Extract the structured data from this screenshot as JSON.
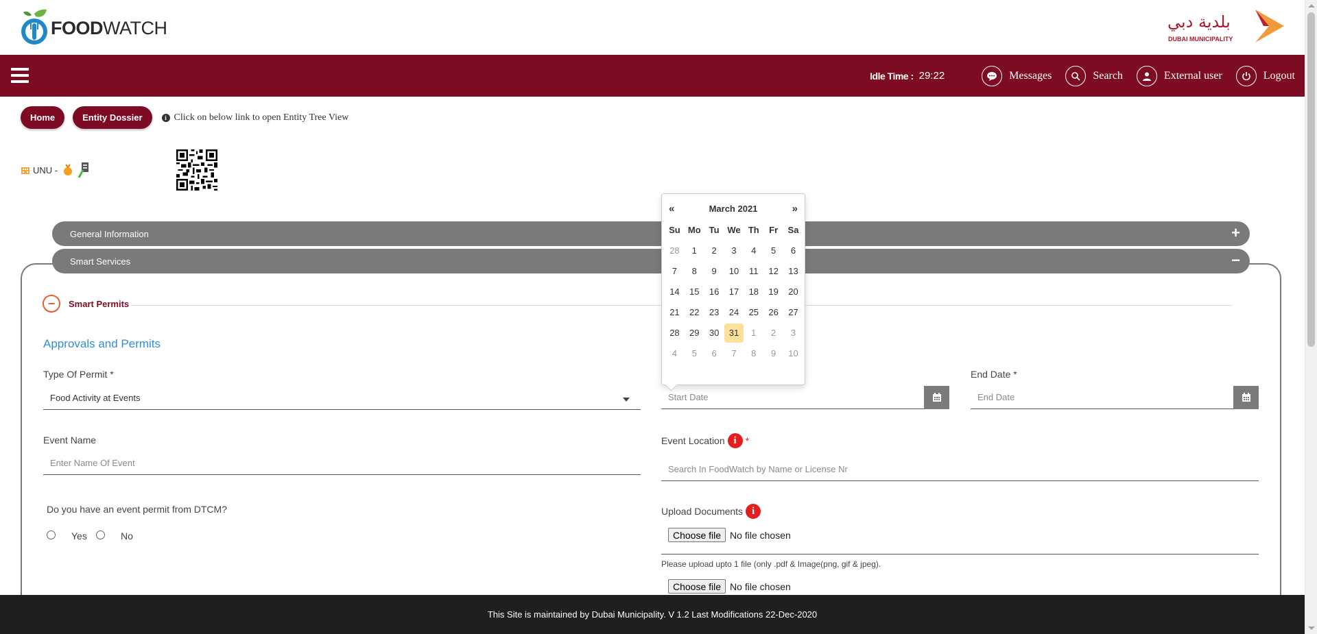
{
  "brand": {
    "logo_bold": "FOOD",
    "logo_light": "WATCH",
    "municipality_arabic": "بلدية دبي",
    "municipality_latin": "DUBAI MUNICIPALITY"
  },
  "navbar": {
    "idle_label": "Idle Time :",
    "idle_value": "29:22",
    "items": [
      {
        "label": "Messages",
        "icon": "chat-icon"
      },
      {
        "label": "Search",
        "icon": "search-icon"
      },
      {
        "label": "External user",
        "icon": "user-icon"
      },
      {
        "label": "Logout",
        "icon": "power-icon"
      }
    ]
  },
  "breadcrumb": {
    "home": "Home",
    "dossier": "Entity Dossier",
    "note": "Click on below link to open Entity Tree View"
  },
  "entity": {
    "label": "UNU -"
  },
  "accordion": {
    "general": "General Information",
    "smart": "Smart Services",
    "general_sign": "+",
    "smart_sign": "−"
  },
  "smart_permits": {
    "title": "Smart Permits",
    "section_title": "Approvals and Permits"
  },
  "form": {
    "type_label": "Type Of Permit *",
    "type_value": "Food Activity at Events",
    "start_placeholder": "Start Date",
    "end_label": "End Date *",
    "end_placeholder": "End Date",
    "event_name_label": "Event Name",
    "event_name_placeholder": "Enter Name Of Event",
    "location_label": "Event Location",
    "location_placeholder": "Search In FoodWatch by Name or License Nr",
    "dtcm_question": "Do you have an event permit from DTCM?",
    "yes": "Yes",
    "no": "No",
    "upload_label": "Upload Documents",
    "choose_file": "Choose file",
    "no_file": "No file chosen",
    "upload_hint": "Please upload upto 1 file (only .pdf & Image(png, gif & jpeg).",
    "required_mark": "*",
    "info_glyph": "i"
  },
  "datepicker": {
    "prev": "«",
    "next": "»",
    "month": "March 2021",
    "dow": [
      "Su",
      "Mo",
      "Tu",
      "We",
      "Th",
      "Fr",
      "Sa"
    ],
    "weeks": [
      [
        {
          "d": "28",
          "o": true
        },
        {
          "d": "1"
        },
        {
          "d": "2"
        },
        {
          "d": "3"
        },
        {
          "d": "4"
        },
        {
          "d": "5"
        },
        {
          "d": "6"
        }
      ],
      [
        {
          "d": "7"
        },
        {
          "d": "8"
        },
        {
          "d": "9"
        },
        {
          "d": "10"
        },
        {
          "d": "11"
        },
        {
          "d": "12"
        },
        {
          "d": "13"
        }
      ],
      [
        {
          "d": "14"
        },
        {
          "d": "15"
        },
        {
          "d": "16"
        },
        {
          "d": "17"
        },
        {
          "d": "18"
        },
        {
          "d": "19"
        },
        {
          "d": "20"
        }
      ],
      [
        {
          "d": "21"
        },
        {
          "d": "22"
        },
        {
          "d": "23"
        },
        {
          "d": "24"
        },
        {
          "d": "25"
        },
        {
          "d": "26"
        },
        {
          "d": "27"
        }
      ],
      [
        {
          "d": "28"
        },
        {
          "d": "29"
        },
        {
          "d": "30"
        },
        {
          "d": "31",
          "t": true
        },
        {
          "d": "1",
          "o": true
        },
        {
          "d": "2",
          "o": true
        },
        {
          "d": "3",
          "o": true
        }
      ],
      [
        {
          "d": "4",
          "o": true
        },
        {
          "d": "5",
          "o": true
        },
        {
          "d": "6",
          "o": true
        },
        {
          "d": "7",
          "o": true
        },
        {
          "d": "8",
          "o": true
        },
        {
          "d": "9",
          "o": true
        },
        {
          "d": "10",
          "o": true
        }
      ]
    ]
  },
  "footer": {
    "text": "This Site is maintained by Dubai Municipality. V 1.2 Last Modifications 22-Dec-2020"
  },
  "colors": {
    "brand_maroon": "#7d0b24",
    "accordion_grey": "#7a7a7b",
    "link_blue": "#2f8fd8",
    "today_highlight": "#fde19a",
    "required_red": "#e41e1e"
  }
}
